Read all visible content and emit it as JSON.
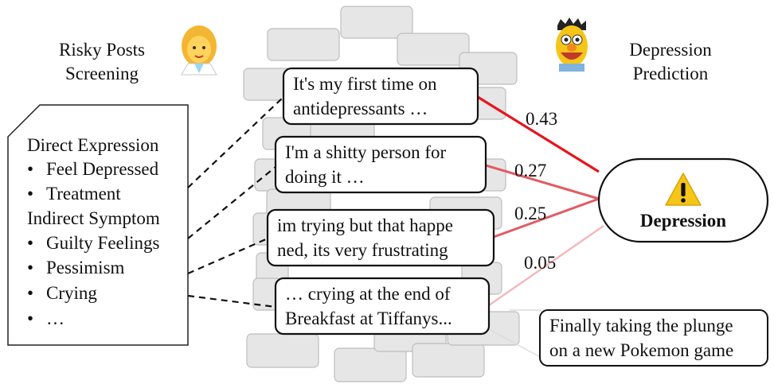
{
  "left_heading": {
    "line1": "Risky Posts",
    "line2": "Screening",
    "emoji": "👩‍⚕️"
  },
  "right_heading": {
    "line1": "Depression",
    "line2": "Prediction",
    "emoji": "🤖"
  },
  "criteria": {
    "group1": "Direct Expression",
    "group1_items": [
      "Feel Depressed",
      "Treatment"
    ],
    "group2": "Indirect Symptom",
    "group2_items": [
      "Guilty Feelings",
      "Pessimism",
      "Crying",
      "…"
    ]
  },
  "posts": [
    {
      "line1": "It's my first time on",
      "line2": "antidepressants …",
      "weight": "0.43"
    },
    {
      "line1": "I'm a shitty person for",
      "line2": "doing it …",
      "weight": "0.27"
    },
    {
      "line1": "im trying but that happe",
      "line2": "ned, its very frustrating",
      "weight": "0.25"
    },
    {
      "line1": "… crying at the end of",
      "line2": "Breakfast at Tiffanys...",
      "weight": "0.05"
    }
  ],
  "ignored_post": {
    "line1": "Finally taking the plunge",
    "line2": "on a new Pokemon game"
  },
  "output": {
    "icon": "⚠",
    "label": "Depression"
  },
  "colors": {
    "strong_edge": "#e8141c",
    "mid_edge": "#e35b63",
    "weak_edge": "#f3b6ba",
    "brick": "#e6e6e6",
    "brick_stroke": "#bdbdbd"
  }
}
